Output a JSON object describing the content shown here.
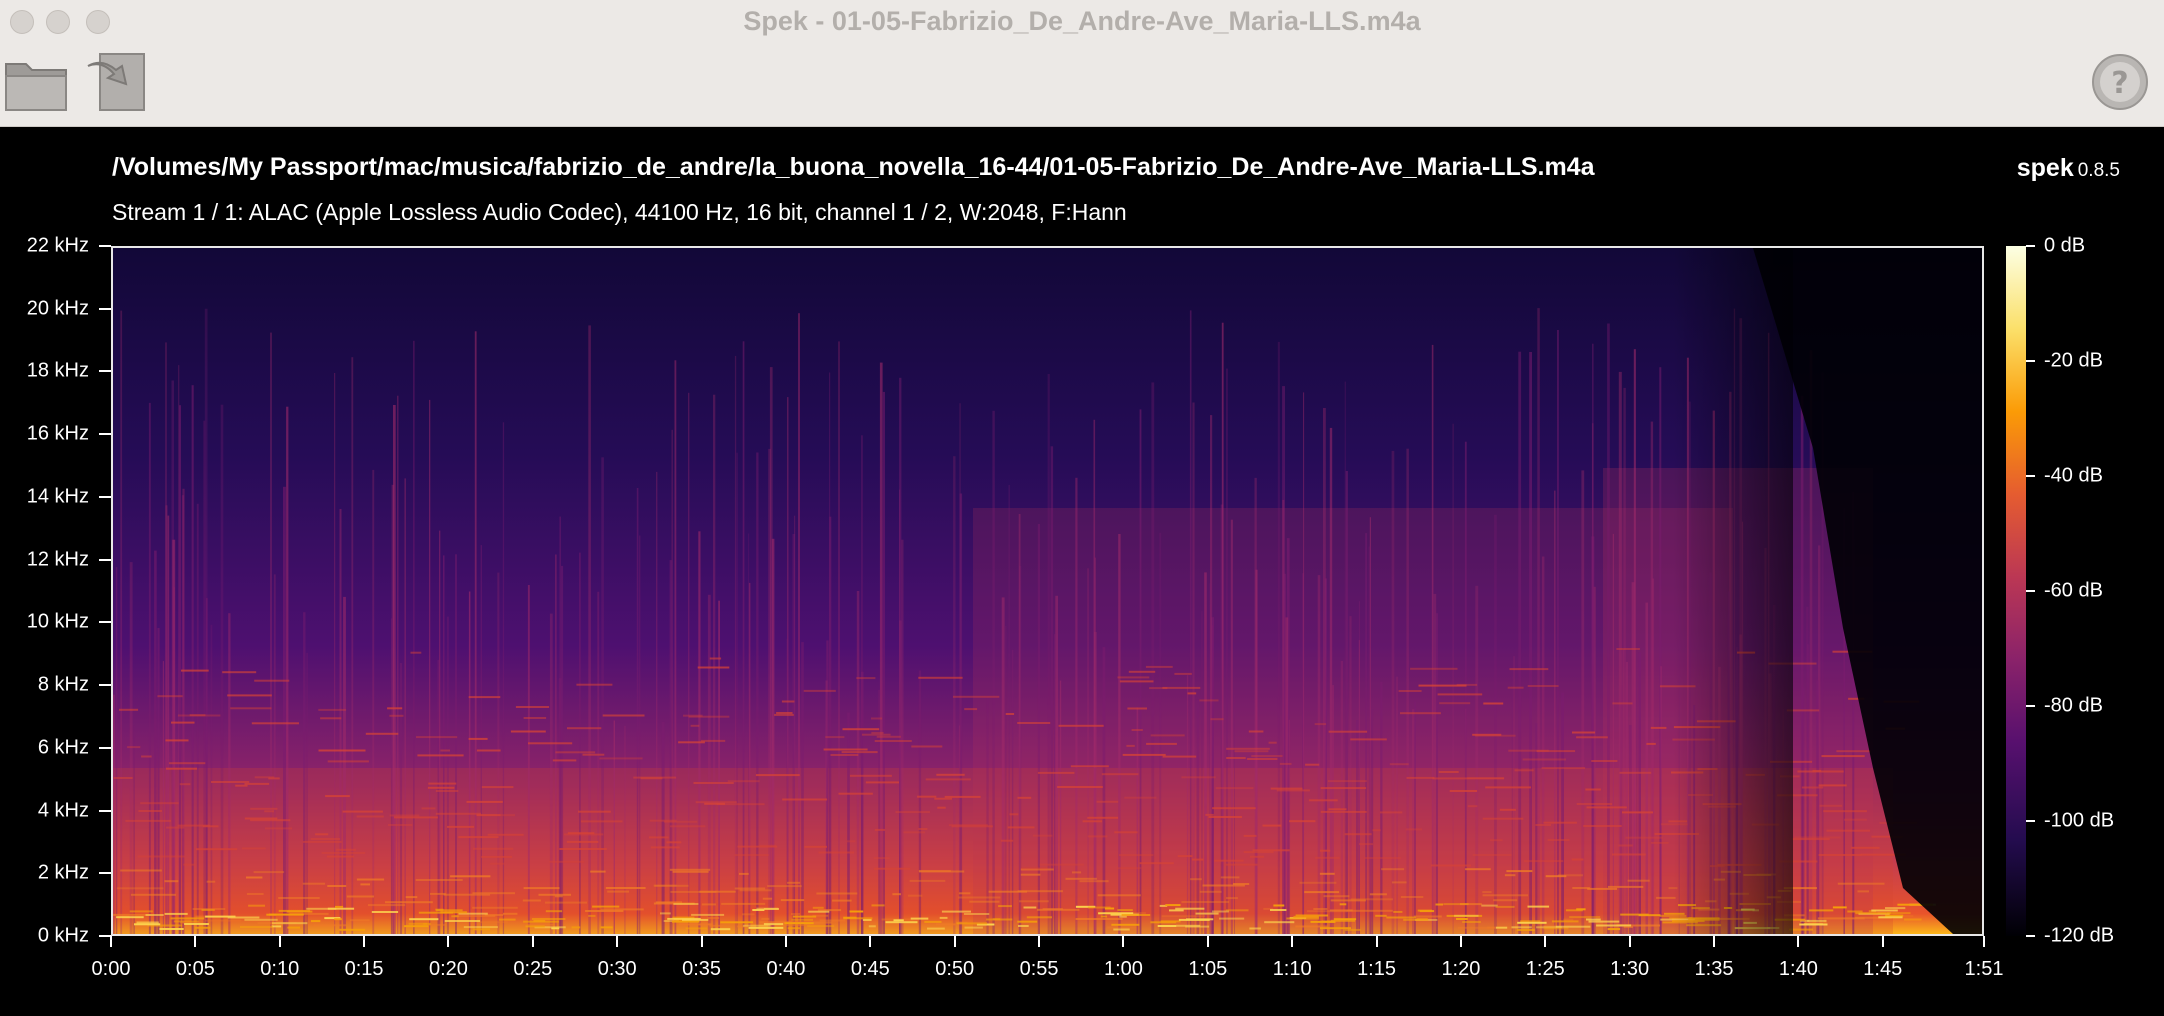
{
  "window": {
    "title": "Spek - 01-05-Fabrizio_De_Andre-Ave_Maria-LLS.m4a"
  },
  "toolbar": {
    "open_icon": "folder-icon",
    "save_icon": "save-icon",
    "help_icon": "help-icon"
  },
  "header": {
    "file_path": "/Volumes/My Passport/mac/musica/fabrizio_de_andre/la_buona_novella_16-44/01-05-Fabrizio_De_Andre-Ave_Maria-LLS.m4a",
    "stream_info": "Stream 1 / 1: ALAC (Apple Lossless Audio Codec), 44100 Hz, 16 bit, channel 1 / 2, W:2048, F:Hann",
    "app_name": "spek",
    "app_version": "0.8.5"
  },
  "chart_data": {
    "type": "heatmap",
    "xlabel": "",
    "ylabel": "",
    "x_ticks": [
      "0:00",
      "0:05",
      "0:10",
      "0:15",
      "0:20",
      "0:25",
      "0:30",
      "0:35",
      "0:40",
      "0:45",
      "0:50",
      "0:55",
      "1:00",
      "1:05",
      "1:10",
      "1:15",
      "1:20",
      "1:25",
      "1:30",
      "1:35",
      "1:40",
      "1:45",
      "1:51"
    ],
    "x_range_seconds": [
      0,
      111
    ],
    "y_ticks": [
      "0 kHz",
      "2 kHz",
      "4 kHz",
      "6 kHz",
      "8 kHz",
      "10 kHz",
      "12 kHz",
      "14 kHz",
      "16 kHz",
      "18 kHz",
      "20 kHz",
      "22 kHz"
    ],
    "y_range_khz": [
      0,
      22
    ],
    "colorbar_ticks": [
      "0 dB",
      "-20 dB",
      "-40 dB",
      "-60 dB",
      "-80 dB",
      "-100 dB",
      "-120 dB"
    ],
    "colorbar_range_db": [
      -120,
      0
    ],
    "colormap": [
      "#000004",
      "#240c4f",
      "#57106e",
      "#8a226a",
      "#bb3754",
      "#e55c30",
      "#fb9b06",
      "#fbe06a",
      "#fcffe4"
    ],
    "background_color": "#0a0420"
  }
}
